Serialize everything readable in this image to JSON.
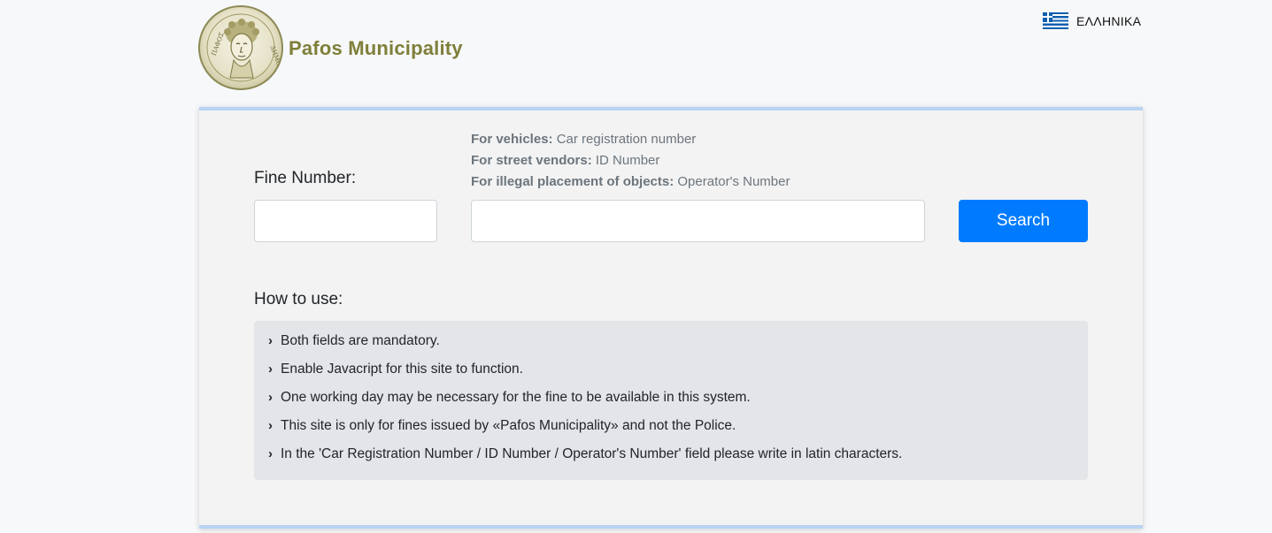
{
  "header": {
    "brand": "Pafos Municipality",
    "language_label": "ΕΛΛΗΝΙΚΑ"
  },
  "form": {
    "fine_number_label": "Fine Number:",
    "hints": [
      {
        "bold": "For vehicles:",
        "text": " Car registration number"
      },
      {
        "bold": "For street vendors:",
        "text": " ID Number"
      },
      {
        "bold": "For illegal placement of objects:",
        "text": " Operator's Number"
      }
    ],
    "fine_number_value": "",
    "registration_value": "",
    "search_label": "Search"
  },
  "howto": {
    "title": "How to use:",
    "items": [
      "Both fields are mandatory.",
      "Enable Javacript for this site to function.",
      "One working day may be necessary for the fine to be available in this system.",
      "This site is only for fines issued by «Pafos Municipality» and not the Police.",
      "In the 'Car Registration Number / ID Number / Operator's Number' field please write in latin characters."
    ]
  },
  "colors": {
    "brand_text": "#7f7f3a",
    "primary_button": "#007bff",
    "card_accent": "#b9d3f3"
  },
  "icons": {
    "logo": "pafos-municipality-seal-icon",
    "language": "greek-flag-icon",
    "list_bullet": "chevron-right-icon"
  }
}
